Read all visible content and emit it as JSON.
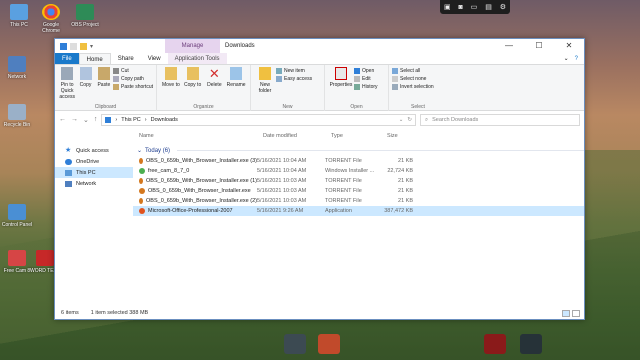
{
  "desktop": {
    "icons": [
      {
        "label": "This PC",
        "color": "#5aa0e0"
      },
      {
        "label": "Google Chrome",
        "color": "#e94335"
      },
      {
        "label": "OBS Project",
        "color": "#2e8b57"
      },
      {
        "label": "Network",
        "color": "#4f7fbf"
      },
      {
        "label": "Recycle Bin",
        "color": "#9ab0c8"
      },
      {
        "label": "Control Panel",
        "color": "#4a8fd4"
      },
      {
        "label": "Free Cam 8",
        "color": "#d64545"
      },
      {
        "label": "WORD TEXT",
        "color": "#c62828"
      }
    ]
  },
  "window": {
    "title": "Downloads",
    "manage_tab": "Manage",
    "controls": {
      "minimize": "—",
      "maximize": "☐",
      "close": "✕"
    },
    "tabs": [
      "File",
      "Home",
      "Share",
      "View",
      "Application Tools"
    ],
    "help_icon": "?"
  },
  "ribbon": {
    "clipboard": {
      "label": "Clipboard",
      "pin": "Pin to Quick access",
      "copy": "Copy",
      "paste": "Paste",
      "cut": "Cut",
      "copy_path": "Copy path",
      "paste_shortcut": "Paste shortcut"
    },
    "organize": {
      "label": "Organize",
      "move_to": "Move to",
      "copy_to": "Copy to",
      "delete": "Delete",
      "rename": "Rename"
    },
    "new": {
      "label": "New",
      "new_folder": "New folder",
      "new_item": "New item",
      "easy_access": "Easy access"
    },
    "open": {
      "label": "Open",
      "properties": "Properties",
      "open": "Open",
      "edit": "Edit",
      "history": "History"
    },
    "select": {
      "label": "Select",
      "select_all": "Select all",
      "select_none": "Select none",
      "invert_selection": "Invert selection"
    }
  },
  "address": {
    "crumbs": [
      "This PC",
      "Downloads"
    ],
    "search_placeholder": "Search Downloads"
  },
  "nav_pane": {
    "items": [
      {
        "label": "Quick access",
        "icon": "star-icon",
        "color": "#2f7fd8"
      },
      {
        "label": "OneDrive",
        "icon": "cloud-icon",
        "color": "#2f7fd8"
      },
      {
        "label": "This PC",
        "icon": "computer-icon",
        "color": "#5a9ad8"
      },
      {
        "label": "Network",
        "icon": "network-icon",
        "color": "#4f7fbf"
      }
    ],
    "selected_index": 2
  },
  "columns": {
    "name": "Name",
    "date": "Date modified",
    "type": "Type",
    "size": "Size"
  },
  "group": {
    "label": "Today (6)"
  },
  "files": [
    {
      "name": "OBS_0_659b_With_Browser_Installer.exe (3)",
      "date": "5/16/2021 10:04 AM",
      "type": "TORRENT File",
      "size": "21 KB",
      "color": "#d4781f"
    },
    {
      "name": "free_cam_8_7_0",
      "date": "5/16/2021 10:04 AM",
      "type": "Windows Installer ...",
      "size": "22,724 KB",
      "color": "#4caf50"
    },
    {
      "name": "OBS_0_659b_With_Browser_Installer.exe (1)",
      "date": "5/16/2021 10:03 AM",
      "type": "TORRENT File",
      "size": "21 KB",
      "color": "#d4781f"
    },
    {
      "name": "OBS_0_659b_With_Browser_Installer.exe",
      "date": "5/16/2021 10:03 AM",
      "type": "TORRENT File",
      "size": "21 KB",
      "color": "#d4781f"
    },
    {
      "name": "OBS_0_659b_With_Browser_Installer.exe (2)",
      "date": "5/16/2021 10:03 AM",
      "type": "TORRENT File",
      "size": "21 KB",
      "color": "#d4781f"
    },
    {
      "name": "Microsoft-Office-Professional-2007",
      "date": "5/16/2021 9:26 AM",
      "type": "Application",
      "size": "387,472 KB",
      "color": "#e0531f"
    }
  ],
  "selected_file_index": 5,
  "status": {
    "count": "6 items",
    "selection": "1 item selected  388 MB"
  }
}
